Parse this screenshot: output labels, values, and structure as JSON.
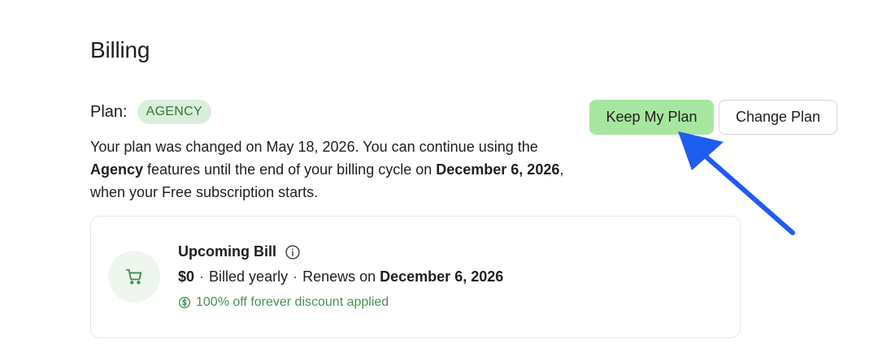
{
  "billing": {
    "title": "Billing"
  },
  "plan": {
    "label": "Plan:",
    "badge": "AGENCY",
    "desc_part1": "Your plan was changed on May 18, 2026. You can continue using the ",
    "desc_plan": "Agency",
    "desc_part2": " features until the end of your billing cycle on ",
    "desc_date": "December 6, 2026",
    "desc_part3": ", when your Free subscription starts."
  },
  "actions": {
    "keep_label": "Keep My Plan",
    "change_label": "Change Plan"
  },
  "upcoming_bill": {
    "title": "Upcoming Bill",
    "amount": "$0",
    "sep1": "·",
    "billing_cycle": "Billed yearly",
    "sep2": "·",
    "renews_prefix": "Renews on ",
    "renews_date": "December 6, 2026",
    "discount": "100% off forever discount applied"
  },
  "colors": {
    "accent_green": "#a7e6a0",
    "badge_bg": "#dbeedc",
    "badge_text": "#2f7a38",
    "discount_text": "#4c8f55",
    "arrow_blue": "#1f5cf0"
  },
  "icons": {
    "info": "info-icon",
    "cart": "cart-icon",
    "dollar": "dollar-circle-icon",
    "arrow": "pointer-arrow"
  }
}
